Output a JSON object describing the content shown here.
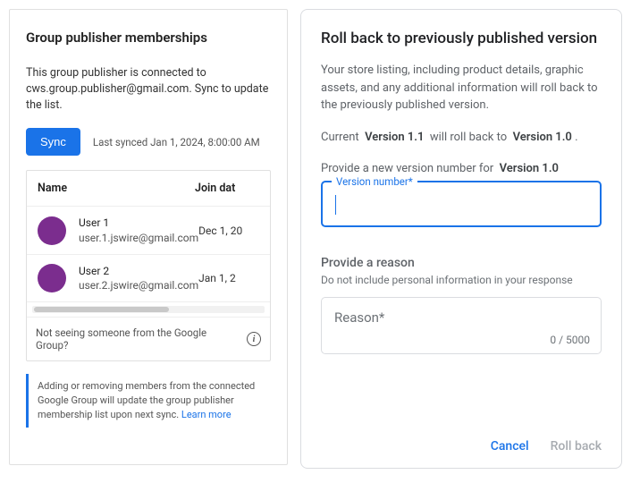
{
  "left": {
    "title": "Group publisher memberships",
    "description": "This group publisher is connected to cws.group.publisher@gmail.com. Sync to update the list.",
    "sync_label": "Sync",
    "last_synced": "Last synced Jan 1, 2024, 8:00:00 AM",
    "columns": {
      "name": "Name",
      "join": "Join dat"
    },
    "rows": [
      {
        "name": "User 1",
        "email": "user.1.jswire@gmail.com",
        "joined": "Dec 1, 20"
      },
      {
        "name": "User 2",
        "email": "user.2.jswire@gmail.com",
        "joined": "Jan 1, 2"
      }
    ],
    "not_seeing": "Not seeing someone from the Google Group?",
    "footer_text": "Adding or removing members from the connected Google Group will update the group publisher membership list upon next sync. ",
    "learn_more": "Learn more"
  },
  "right": {
    "title": "Roll back to previously published version",
    "description": "Your store listing, including product details, graphic assets, and any additional information will roll back to the previously published version.",
    "current_label": "Current",
    "current_version": "Version 1.1",
    "will_roll_back_to": "will roll back to",
    "target_version": "Version 1.0",
    "provide_number_prefix": "Provide a new version number for",
    "provide_number_version": "Version 1.0",
    "version_field_label": "Version number*",
    "reason_heading": "Provide a reason",
    "reason_subtext": "Do not include personal information in your response",
    "reason_placeholder": "Reason*",
    "reason_counter": "0 / 5000",
    "cancel": "Cancel",
    "rollback": "Roll back"
  }
}
